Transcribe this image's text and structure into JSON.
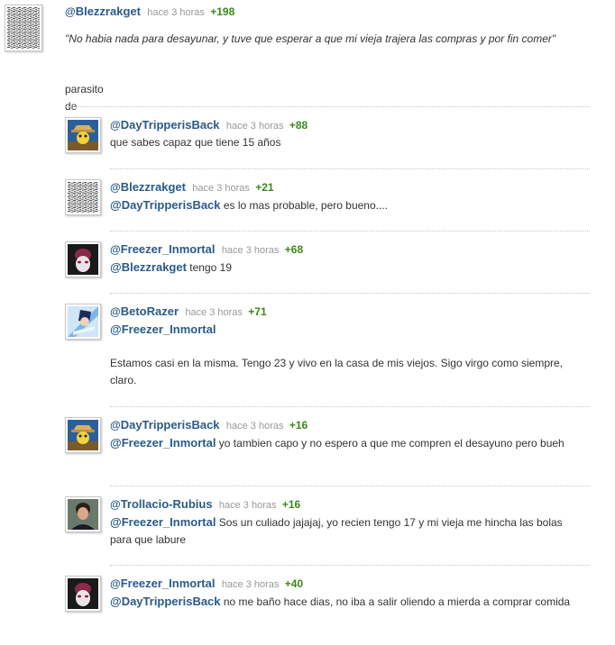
{
  "root": {
    "author": "Blezzrakget",
    "time": "hace 3 horas",
    "score": "+198",
    "quote": "\"No habia nada para desayunar, y tuve que esperar a que mi vieja trajera las compras y por fin comer\"",
    "text": "parasito de mierda",
    "avatar": "static-noise-avatar"
  },
  "replies": [
    {
      "author": "DayTripperisBack",
      "time": "hace 3 horas",
      "score": "+88",
      "mention": "",
      "text": "que sabes capaz que tiene 15 años",
      "avatar": "cartoon-hat-avatar"
    },
    {
      "author": "Blezzrakget",
      "time": "hace 3 horas",
      "score": "+21",
      "mention": "DayTripperisBack",
      "text": "es lo mas probable, pero bueno....",
      "avatar": "static-noise-avatar"
    },
    {
      "author": "Freezer_Inmortal",
      "time": "hace 3 horas",
      "score": "+68",
      "mention": "Blezzrakget",
      "text": "tengo 19",
      "avatar": "alien-face-avatar"
    },
    {
      "author": "BetoRazer",
      "time": "hace 3 horas",
      "score": "+71",
      "mention": "Freezer_Inmortal",
      "text": "Estamos casi en la misma. Tengo 23 y vivo en la casa de mis viejos. Sigo virgo como siempre, claro.",
      "avatar": "anime-blue-avatar"
    },
    {
      "author": "DayTripperisBack",
      "time": "hace 3 horas",
      "score": "+16",
      "mention": "Freezer_Inmortal",
      "text": "yo tambien capo y no espero a que me compren el desayuno pero bueh",
      "avatar": "cartoon-hat-avatar"
    },
    {
      "author": "Trollacio-Rubius",
      "time": "hace 3 horas",
      "score": "+16",
      "mention": "Freezer_Inmortal",
      "text": "Sos un culiado jajajaj, yo recien tengo 17 y mi vieja me hincha las bolas para que labure",
      "avatar": "person-photo-avatar"
    },
    {
      "author": "Freezer_Inmortal",
      "time": "hace 3 horas",
      "score": "+40",
      "mention": "DayTripperisBack",
      "text": "no me baño hace dias, no iba a salir oliendo a mierda a comprar comida",
      "avatar": "alien-face-avatar"
    }
  ]
}
